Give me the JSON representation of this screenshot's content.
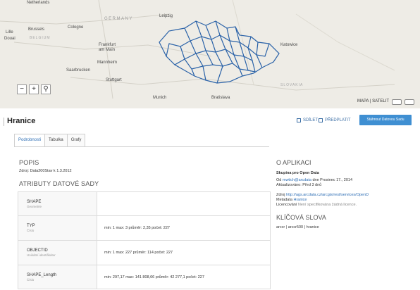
{
  "map": {
    "labels": {
      "netherlands": "Netherlands",
      "germany": "GERMANY",
      "leipzig": "Leipzig",
      "brussels": "Brussels",
      "cologne": "Cologne",
      "lille": "Lille",
      "belgium": "BELGIUM",
      "douai": "Douai",
      "frankfurt": "Frankfurt\nam Main",
      "mannheim": "Mannheim",
      "saarbrucken": "Saarbrucken",
      "stuttgart": "Stuttgart",
      "munich": "Munich",
      "bratislava": "Bratislava",
      "katowice": "Katowice",
      "slovakia": "SLOVAKIA"
    },
    "zoom_out": "−",
    "zoom_in": "+",
    "search_glyph": "⚲",
    "map_type": "MAPA | SATELIT"
  },
  "header": {
    "title": "Hranice",
    "share_label": "SDÍLET",
    "subscribe_label": "PŘEDPLATIT",
    "primary_label": "Stáhnout Datovou Sadu"
  },
  "tabs": [
    "Podrobnosti",
    "Tabulka",
    "Grafy"
  ],
  "details": {
    "popis_heading": "POPIS",
    "source_text": "Zdroj: Data200Stav k 1.3.2012",
    "attributes_heading": "ATRIBUTY DATOVÉ SADY",
    "attributes": [
      {
        "name": "SHAPE",
        "type": "Geometrie",
        "stats": ""
      },
      {
        "name": "TYP",
        "type": "Číslo",
        "stats": "min: 1   max: 3   průměr: 2,35   počet: 227"
      },
      {
        "name": "OBJECTID",
        "type": "Unikátní identifikátor",
        "stats": "min: 1   max: 227   průměr: 114   počet: 227"
      },
      {
        "name": "SHAPE_Length",
        "type": "Číslo",
        "stats": "min: 297,17   max: 141 808,66   průměr: 42 277,1   počet: 227"
      }
    ]
  },
  "sidebar": {
    "about_heading": "O APLIKACI",
    "group": "Skupina pro Open Data",
    "from_prefix": "Od",
    "author": "mwtich@arcdata",
    "date_suffix": "dne Prosinec 17., 2014",
    "updated": "Aktualizováno: Před 3 dnů",
    "source_prefix": "Zdroj",
    "source_link": "http://ags.arcdata.cz/arcgis/rest/services/OpenD",
    "metadata_prefix": "Metadata",
    "metadata_link": "Hranice",
    "license_prefix": "Licencování",
    "license_text": "Není specifikována žádná licence.",
    "keywords_heading": "KLÍČOVÁ SLOVA",
    "keywords": "arccr | arccr500 | hranice"
  },
  "colors": {
    "accent": "#3f8fd2",
    "link": "#2f6fb5",
    "map_boundary": "#2a62a8"
  }
}
